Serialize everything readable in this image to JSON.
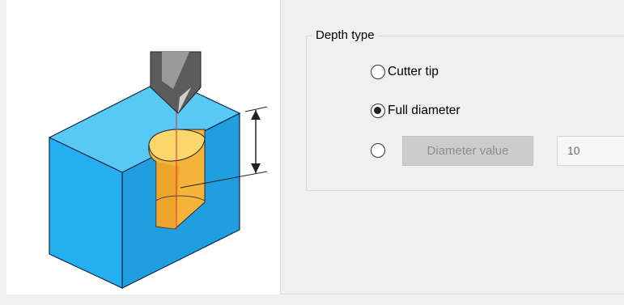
{
  "illustration": {
    "description_icon": "drill-depth-diagram",
    "colors": {
      "block_face": "#21a8e8",
      "block_top": "#46c4f4",
      "hole": "#f4a82a",
      "tool": "#5a5a5a"
    }
  },
  "depth_group": {
    "title": "Depth type",
    "options": [
      {
        "label": "Cutter tip",
        "checked": false
      },
      {
        "label": "Full diameter",
        "checked": true
      },
      {
        "label": "",
        "checked": false
      }
    ],
    "diameter_button_label": "Diameter value",
    "diameter_input_value": "10"
  }
}
